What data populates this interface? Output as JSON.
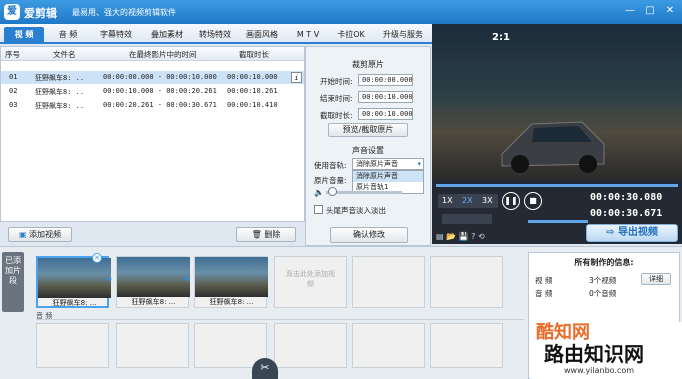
{
  "app": {
    "title": "爱剪辑",
    "slogan": "最易用、强大的视频剪辑软件",
    "logo": "爱"
  },
  "tabs": [
    "视 频",
    "音 频",
    "字幕特效",
    "叠加素材",
    "转场特效",
    "画面风格",
    "M T V",
    "卡拉OK",
    "升级与服务"
  ],
  "clips": {
    "headers": [
      "序号",
      "文件名",
      "在最终影片中的时间",
      "截取时长"
    ],
    "rows": [
      {
        "no": "01",
        "name": "狂野飙车8: ..",
        "span": "00:00:00.000 - 00:00:10.000",
        "dur": "00:00:10.000"
      },
      {
        "no": "02",
        "name": "狂野飙车8: ..",
        "span": "00:00:10.000 - 00:00:20.261",
        "dur": "00:00:10.261"
      },
      {
        "no": "03",
        "name": "狂野飙车8: ..",
        "span": "00:00:20.261 - 00:00:30.671",
        "dur": "00:00:10.410"
      }
    ],
    "add_label": "添加视频",
    "delete_label": "删除"
  },
  "settings": {
    "cut_title": "裁剪原片",
    "start_label": "开始时间:",
    "start_val": "00:00:00.000",
    "end_label": "结束时间:",
    "end_val": "00:00:10.000",
    "len_label": "截取时长:",
    "len_val": "00:00:10.000",
    "preview_btn": "预览/截取原片",
    "audio_title": "声音设置",
    "track_label": "使用音轨:",
    "track_val": "消除原片声音",
    "options": [
      "消除原片声音",
      "原片音轨1"
    ],
    "volume_label": "原片音量:",
    "fade_label": "头尾声音淡入淡出",
    "confirm_btn": "确认修改"
  },
  "preview": {
    "hud": "2:1",
    "speed_opts": [
      "1X",
      "2X",
      "3X"
    ],
    "active_speed": "2X",
    "time_cur": "00:00:30.080",
    "time_total": "00:00:30.671",
    "export_label": "导出视频"
  },
  "timeline": {
    "side_label": "已添加片段",
    "clips": [
      "狂野飙车8: ...",
      "狂野飙车8: ...",
      "狂野飙车8: ..."
    ],
    "empty_hint": "双击此处添加视频",
    "audio_label": "音 频"
  },
  "info": {
    "title": "所有制作的信息:",
    "rows": [
      {
        "k": "视 频",
        "v": "3个视频",
        "btn": "详细"
      },
      {
        "k": "音 频",
        "v": "0个音频"
      }
    ]
  },
  "watermark": {
    "brand": "酷知网",
    "site_cn": "路由知识网",
    "site_url": "www.yilanbo.com"
  }
}
